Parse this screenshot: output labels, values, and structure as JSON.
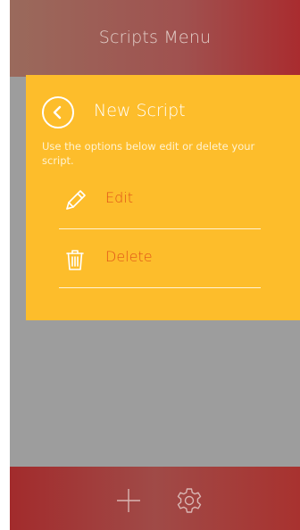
{
  "header": {
    "title": "Scripts Menu"
  },
  "panel": {
    "title": "New Script",
    "description": "Use the options below edit or delete your script.",
    "back_icon": "chevron-left-icon",
    "options": [
      {
        "label": "Edit",
        "icon": "pencil-icon"
      },
      {
        "label": "Delete",
        "icon": "trash-icon"
      }
    ]
  },
  "footer": {
    "add_icon": "plus-icon",
    "settings_icon": "gear-icon"
  },
  "colors": {
    "panel_background": "#fdbd2b",
    "option_label": "#e05418",
    "header_gradient_end": "#a92c2f",
    "content_background": "#9d9d9d"
  }
}
